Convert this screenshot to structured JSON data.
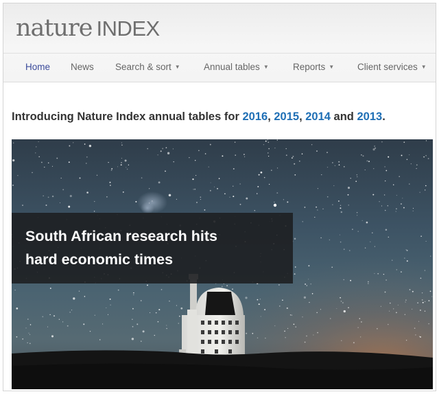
{
  "logo": {
    "nature": "nature",
    "index": "INDEX"
  },
  "nav": {
    "items": [
      {
        "label": "Home",
        "active": true,
        "dropdown": false
      },
      {
        "label": "News",
        "active": false,
        "dropdown": false
      },
      {
        "label": "Search & sort",
        "active": false,
        "dropdown": true
      },
      {
        "label": "Annual tables",
        "active": false,
        "dropdown": true
      },
      {
        "label": "Reports",
        "active": false,
        "dropdown": true
      },
      {
        "label": "Client services",
        "active": false,
        "dropdown": true
      }
    ]
  },
  "intro": {
    "prefix": "Introducing Nature Index annual tables for ",
    "year1": "2016",
    "sep1": ", ",
    "year2": "2015",
    "sep2": ", ",
    "year3": "2014",
    "and": " and ",
    "year4": "2013",
    "suffix": "."
  },
  "hero": {
    "headline_line1": "South African research hits",
    "headline_line2": "hard economic times"
  },
  "colors": {
    "nav_active": "#3a4a9a",
    "link_blue": "#1f6fb5",
    "headline_box": "#1c1e20"
  }
}
